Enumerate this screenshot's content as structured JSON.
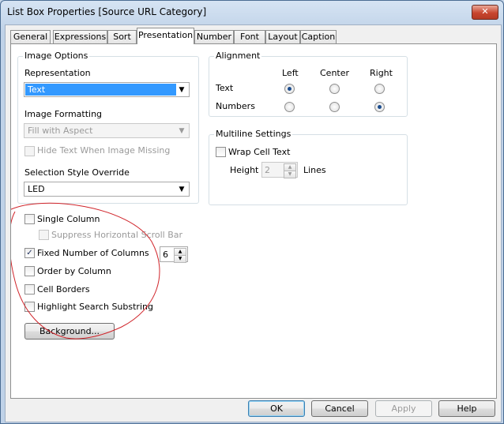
{
  "window": {
    "title": "List Box Properties [Source URL Category]",
    "close_glyph": "✕"
  },
  "tabs": [
    {
      "label": "General"
    },
    {
      "label": "Expressions"
    },
    {
      "label": "Sort"
    },
    {
      "label": "Presentation",
      "active": true
    },
    {
      "label": "Number"
    },
    {
      "label": "Font"
    },
    {
      "label": "Layout"
    },
    {
      "label": "Caption"
    }
  ],
  "image_options": {
    "group_label": "Image Options",
    "representation_label": "Representation",
    "representation_value": "Text",
    "image_formatting_label": "Image Formatting",
    "image_formatting_value": "Fill with Aspect",
    "hide_text_label": "Hide Text When Image Missing"
  },
  "selection_style": {
    "label": "Selection Style Override",
    "value": "LED"
  },
  "alignment": {
    "group_label": "Alignment",
    "col_left": "Left",
    "col_center": "Center",
    "col_right": "Right",
    "row_text": "Text",
    "row_numbers": "Numbers",
    "text_selected": "Left",
    "numbers_selected": "Right"
  },
  "multiline": {
    "group_label": "Multiline Settings",
    "wrap_label": "Wrap Cell Text",
    "height_label": "Height",
    "height_value": "2",
    "lines_label": "Lines"
  },
  "options": {
    "single_column": "Single Column",
    "suppress_scroll": "Suppress Horizontal Scroll Bar",
    "fixed_columns": "Fixed Number of Columns",
    "fixed_columns_value": "6",
    "order_by_column": "Order by Column",
    "cell_borders": "Cell Borders",
    "highlight_search": "Highlight Search Substring",
    "fixed_columns_checked": true
  },
  "buttons": {
    "background": "Background...",
    "ok": "OK",
    "cancel": "Cancel",
    "apply": "Apply",
    "help": "Help"
  },
  "glyphs": {
    "check": "✓",
    "dropdown": "▼",
    "spin_up": "▲",
    "spin_down": "▼"
  },
  "colors": {
    "selection_blue": "#3399ff",
    "annotation_red": "#d0242a"
  }
}
